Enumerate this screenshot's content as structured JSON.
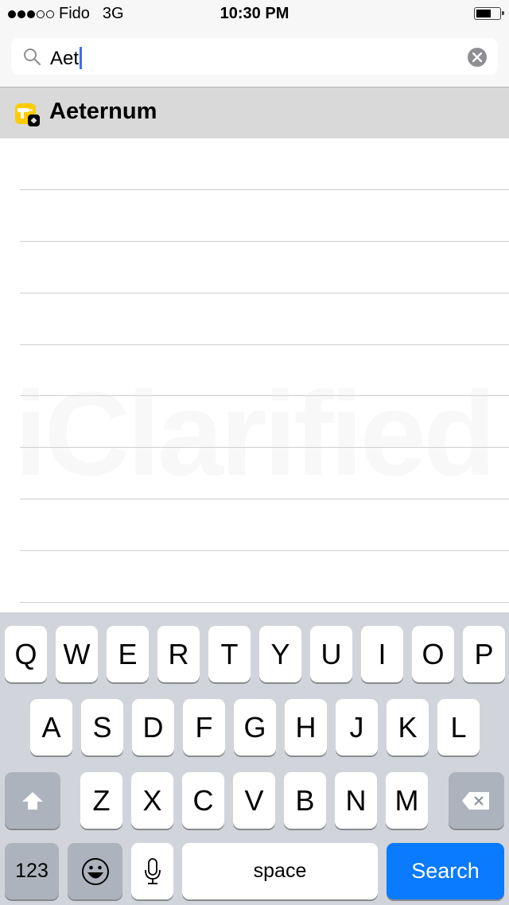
{
  "status_bar": {
    "signal_bars_filled": 3,
    "signal_bars_total": 5,
    "carrier": "Fido",
    "network": "3G",
    "time": "10:30 PM",
    "battery_level": 0.55
  },
  "search": {
    "query": "Aet",
    "clear_icon": "clear-circle-icon",
    "search_icon": "magnifier-icon"
  },
  "results": [
    {
      "title": "Aeternum",
      "icon": "yellow-drill-app-icon",
      "badge": "cydia-package-badge"
    }
  ],
  "watermark": "iClarified",
  "keyboard": {
    "row1": [
      "Q",
      "W",
      "E",
      "R",
      "T",
      "Y",
      "U",
      "I",
      "O",
      "P"
    ],
    "row2": [
      "A",
      "S",
      "D",
      "F",
      "G",
      "H",
      "J",
      "K",
      "L"
    ],
    "row3": [
      "Z",
      "X",
      "C",
      "V",
      "B",
      "N",
      "M"
    ],
    "shift_icon": "shift-arrow-icon",
    "delete_icon": "backspace-icon",
    "numbers_label": "123",
    "emoji_icon": "emoji-smiley-icon",
    "mic_icon": "microphone-icon",
    "space_label": "space",
    "return_label": "Search",
    "colors": {
      "return_key": "#0a7aff",
      "background": "#d1d5db"
    }
  }
}
